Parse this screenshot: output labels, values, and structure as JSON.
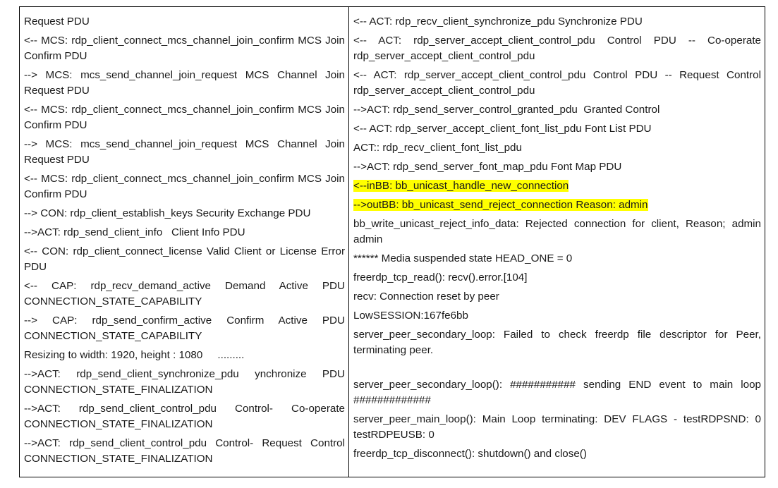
{
  "left_column": [
    {
      "text": "Request PDU"
    },
    {
      "text": "<-- MCS: rdp_client_connect_mcs_channel_join_confirm MCS Join Confirm PDU"
    },
    {
      "text": "--> MCS: mcs_send_channel_join_request MCS Channel Join Request PDU"
    },
    {
      "text": "<-- MCS: rdp_client_connect_mcs_channel_join_confirm MCS Join Confirm PDU"
    },
    {
      "text": "--> MCS: mcs_send_channel_join_request MCS Channel Join Request PDU"
    },
    {
      "text": "<-- MCS: rdp_client_connect_mcs_channel_join_confirm MCS Join Confirm PDU"
    },
    {
      "text": "--> CON: rdp_client_establish_keys Security Exchange PDU"
    },
    {
      "text": "-->ACT: rdp_send_client_info   Client Info PDU"
    },
    {
      "text": "<-- CON: rdp_client_connect_license Valid Client or License Error PDU"
    },
    {
      "text": "<-- CAP: rdp_recv_demand_active   Demand Active PDU CONNECTION_STATE_CAPABILITY"
    },
    {
      "text": "--> CAP: rdp_send_confirm_active   Confirm Active PDU CONNECTION_STATE_CAPABILITY"
    },
    {
      "text": "Resizing to width: 1920, height : 1080     ........."
    },
    {
      "text": "-->ACT: rdp_send_client_synchronize_pdu     ynchronize PDU CONNECTION_STATE_FINALIZATION"
    },
    {
      "text": "-->ACT: rdp_send_client_control_pdu   Control- Co-operate CONNECTION_STATE_FINALIZATION"
    },
    {
      "text": "-->ACT: rdp_send_client_control_pdu   Control- Request Control  CONNECTION_STATE_FINALIZATION"
    }
  ],
  "right_column": [
    {
      "text": "<-- ACT: rdp_recv_client_synchronize_pdu Synchronize PDU"
    },
    {
      "text": "<-- ACT: rdp_server_accept_client_control_pdu Control PDU -- Co-operate rdp_server_accept_client_control_pdu"
    },
    {
      "text": "<-- ACT: rdp_server_accept_client_control_pdu Control PDU -- Request Control rdp_server_accept_client_control_pdu"
    },
    {
      "text": "-->ACT: rdp_send_server_control_granted_pdu  Granted Control"
    },
    {
      "text": "<-- ACT: rdp_server_accept_client_font_list_pdu Font List PDU"
    },
    {
      "text": "ACT:: rdp_recv_client_font_list_pdu"
    },
    {
      "text": "-->ACT: rdp_send_server_font_map_pdu Font Map PDU"
    },
    {
      "text": "<--inBB: bb_unicast_handle_new_connection",
      "highlight": true
    },
    {
      "text": "-->outBB: bb_unicast_send_reject_connection Reason: admin",
      "highlight": true
    },
    {
      "text": "bb_write_unicast_reject_info_data: Rejected connection for client, Reason; admin admin"
    },
    {
      "text": "****** Media suspended state HEAD_ONE = 0"
    },
    {
      "text": "freerdp_tcp_read(): recv().error.[104]"
    },
    {
      "text": "recv: Connection reset by peer"
    },
    {
      "text": "LowSESSION:167fe6bb"
    },
    {
      "text": " server_peer_secondary_loop: Failed to check freerdp file descriptor for Peer, terminating peer.",
      "gap_after": true
    },
    {
      "text": "server_peer_secondary_loop(): ########### sending END event to main loop #############"
    },
    {
      "text": "server_peer_main_loop(): Main Loop terminating: DEV FLAGS - testRDPSND: 0 testRDPEUSB: 0"
    },
    {
      "text": "freerdp_tcp_disconnect(): shutdown() and close()"
    }
  ],
  "colors": {
    "highlight": "#ffff00",
    "border": "#000000",
    "text": "#1a1a1a"
  }
}
